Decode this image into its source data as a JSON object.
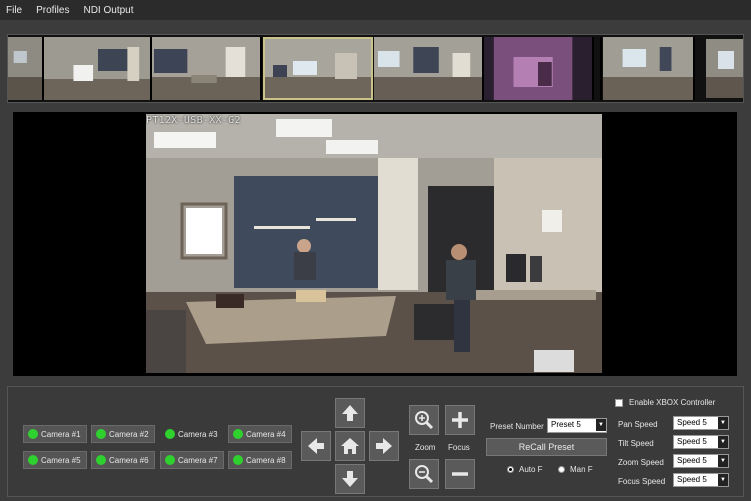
{
  "menu": {
    "items": [
      "File",
      "Profiles",
      "NDI Output"
    ]
  },
  "video": {
    "osd_text": "PT12X-USB-XX-G2"
  },
  "cameras": [
    {
      "label": "Camera #1",
      "online": true,
      "style": "button"
    },
    {
      "label": "Camera #2",
      "online": true,
      "style": "button"
    },
    {
      "label": "Camera #3",
      "online": true,
      "style": "plain"
    },
    {
      "label": "Camera #4",
      "online": true,
      "style": "button"
    },
    {
      "label": "Camera #5",
      "online": true,
      "style": "button"
    },
    {
      "label": "Camera #6",
      "online": true,
      "style": "button"
    },
    {
      "label": "Camera #7",
      "online": true,
      "style": "button"
    },
    {
      "label": "Camera #8",
      "online": true,
      "style": "button"
    }
  ],
  "lens": {
    "zoom_label": "Zoom",
    "focus_label": "Focus"
  },
  "preset": {
    "label": "Preset Number",
    "value": "Preset 5",
    "recall_label": "ReCall Preset"
  },
  "focus_mode": {
    "auto_label": "Auto F",
    "manual_label": "Man F",
    "selected": "auto"
  },
  "xbox": {
    "label": "Enable XBOX Controller",
    "checked": false
  },
  "speeds": {
    "pan_label": "Pan Speed",
    "pan_value": "Speed 5",
    "tilt_label": "Tilt Speed",
    "tilt_value": "Speed 5",
    "zoom_label": "Zoom Speed",
    "zoom_value": "Speed 5",
    "focus_label": "Focus Speed",
    "focus_value": "Speed 5"
  },
  "colors": {
    "status_online": "#2fd12f",
    "thumbnail_selected_border": "#c9c38a",
    "panel_bg": "#3a3a3a"
  },
  "icons": [
    "arrow-up-icon",
    "arrow-down-icon",
    "arrow-left-icon",
    "arrow-right-icon",
    "home-icon",
    "zoom-in-icon",
    "zoom-out-icon",
    "plus-icon",
    "minus-icon",
    "dropdown-arrow-icon"
  ]
}
